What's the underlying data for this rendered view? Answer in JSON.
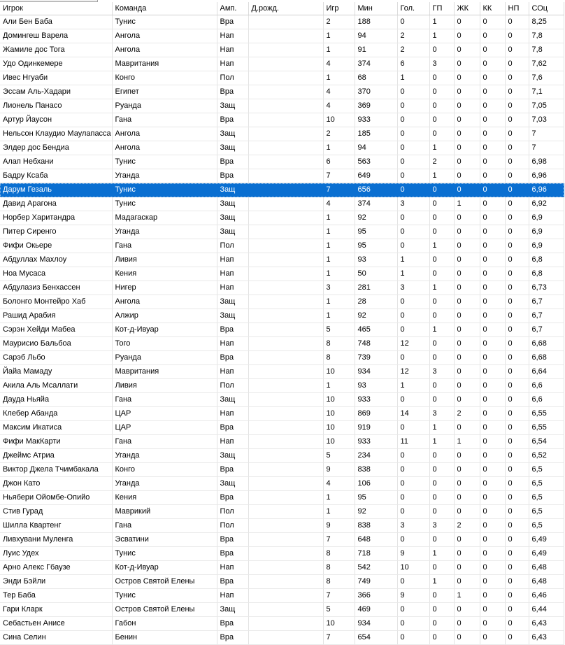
{
  "columns": [
    "Игрок",
    "Команда",
    "Амп.",
    "Д.рожд.",
    "Игр",
    "Мин",
    "Гол.",
    "ГП",
    "ЖК",
    "КК",
    "НП",
    "СОц"
  ],
  "selected_row": 12,
  "colors": {
    "selected_bg": "#0a6fd1",
    "selected_text": "#ffffff",
    "grid_line": "#e3e3e3",
    "background": "#ffffff"
  },
  "rows": [
    [
      "Али Бен Баба",
      "Тунис",
      "Вра",
      "",
      "2",
      "188",
      "0",
      "1",
      "0",
      "0",
      "0",
      "8,25"
    ],
    [
      "Домингеш Варела",
      "Ангола",
      "Нап",
      "",
      "1",
      "94",
      "2",
      "1",
      "0",
      "0",
      "0",
      "7,8"
    ],
    [
      "Жамиле дос Тога",
      "Ангола",
      "Нап",
      "",
      "1",
      "91",
      "2",
      "0",
      "0",
      "0",
      "0",
      "7,8"
    ],
    [
      "Удо Одинкемере",
      "Мавритания",
      "Нап",
      "",
      "4",
      "374",
      "6",
      "3",
      "0",
      "0",
      "0",
      "7,62"
    ],
    [
      "Ивес Нгуаби",
      "Конго",
      "Пол",
      "",
      "1",
      "68",
      "1",
      "0",
      "0",
      "0",
      "0",
      "7,6"
    ],
    [
      "Эссам Аль-Хадари",
      "Египет",
      "Вра",
      "",
      "4",
      "370",
      "0",
      "0",
      "0",
      "0",
      "0",
      "7,1"
    ],
    [
      "Лионель Панасо",
      "Руанда",
      "Защ",
      "",
      "4",
      "369",
      "0",
      "0",
      "0",
      "0",
      "0",
      "7,05"
    ],
    [
      "Артур Йаусон",
      "Гана",
      "Вра",
      "",
      "10",
      "933",
      "0",
      "0",
      "0",
      "0",
      "0",
      "7,03"
    ],
    [
      "Нельсон Клаудио Маулапасса",
      "Ангола",
      "Защ",
      "",
      "2",
      "185",
      "0",
      "0",
      "0",
      "0",
      "0",
      "7"
    ],
    [
      "Элдер дос Бендиа",
      "Ангола",
      "Защ",
      "",
      "1",
      "94",
      "0",
      "1",
      "0",
      "0",
      "0",
      "7"
    ],
    [
      "Алап Небхани",
      "Тунис",
      "Вра",
      "",
      "6",
      "563",
      "0",
      "2",
      "0",
      "0",
      "0",
      "6,98"
    ],
    [
      "Бадру Ксаба",
      "Уганда",
      "Вра",
      "",
      "7",
      "649",
      "0",
      "1",
      "0",
      "0",
      "0",
      "6,96"
    ],
    [
      "Дарум Гезаль",
      "Тунис",
      "Защ",
      "",
      "7",
      "656",
      "0",
      "0",
      "0",
      "0",
      "0",
      "6,96"
    ],
    [
      "Давид Арагона",
      "Тунис",
      "Защ",
      "",
      "4",
      "374",
      "3",
      "0",
      "1",
      "0",
      "0",
      "6,92"
    ],
    [
      "Норбер Харитандра",
      "Мадагаскар",
      "Защ",
      "",
      "1",
      "92",
      "0",
      "0",
      "0",
      "0",
      "0",
      "6,9"
    ],
    [
      "Питер Сиренго",
      "Уганда",
      "Защ",
      "",
      "1",
      "95",
      "0",
      "0",
      "0",
      "0",
      "0",
      "6,9"
    ],
    [
      "Фифи Окьере",
      "Гана",
      "Пол",
      "",
      "1",
      "95",
      "0",
      "1",
      "0",
      "0",
      "0",
      "6,9"
    ],
    [
      "Абдуллах Махлоу",
      "Ливия",
      "Нап",
      "",
      "1",
      "93",
      "1",
      "0",
      "0",
      "0",
      "0",
      "6,8"
    ],
    [
      "Ноа Мусаса",
      "Кения",
      "Нап",
      "",
      "1",
      "50",
      "1",
      "0",
      "0",
      "0",
      "0",
      "6,8"
    ],
    [
      "Абдулазиз Бенхассен",
      "Нигер",
      "Нап",
      "",
      "3",
      "281",
      "3",
      "1",
      "0",
      "0",
      "0",
      "6,73"
    ],
    [
      "Болонго Монтейро Хаб",
      "Ангола",
      "Защ",
      "",
      "1",
      "28",
      "0",
      "0",
      "0",
      "0",
      "0",
      "6,7"
    ],
    [
      "Рашид Арабия",
      "Алжир",
      "Защ",
      "",
      "1",
      "92",
      "0",
      "0",
      "0",
      "0",
      "0",
      "6,7"
    ],
    [
      "Сэрэн Хейди Мабеа",
      "Кот-д-Ивуар",
      "Вра",
      "",
      "5",
      "465",
      "0",
      "1",
      "0",
      "0",
      "0",
      "6,7"
    ],
    [
      "Маурисио Бальбоа",
      "Того",
      "Нап",
      "",
      "8",
      "748",
      "12",
      "0",
      "0",
      "0",
      "0",
      "6,68"
    ],
    [
      "Сарэб Льбо",
      "Руанда",
      "Вра",
      "",
      "8",
      "739",
      "0",
      "0",
      "0",
      "0",
      "0",
      "6,68"
    ],
    [
      "Йайа Мамаду",
      "Мавритания",
      "Нап",
      "",
      "10",
      "934",
      "12",
      "3",
      "0",
      "0",
      "0",
      "6,64"
    ],
    [
      "Акила Аль Мсаллати",
      "Ливия",
      "Пол",
      "",
      "1",
      "93",
      "1",
      "0",
      "0",
      "0",
      "0",
      "6,6"
    ],
    [
      "Дауда Ньяйа",
      "Гана",
      "Защ",
      "",
      "10",
      "933",
      "0",
      "0",
      "0",
      "0",
      "0",
      "6,6"
    ],
    [
      "Клебер Абанда",
      "ЦАР",
      "Нап",
      "",
      "10",
      "869",
      "14",
      "3",
      "2",
      "0",
      "0",
      "6,55"
    ],
    [
      "Максим Икатиса",
      "ЦАР",
      "Вра",
      "",
      "10",
      "919",
      "0",
      "1",
      "0",
      "0",
      "0",
      "6,55"
    ],
    [
      "Фифи МакКарти",
      "Гана",
      "Нап",
      "",
      "10",
      "933",
      "11",
      "1",
      "1",
      "0",
      "0",
      "6,54"
    ],
    [
      "Джеймс Атриа",
      "Уганда",
      "Защ",
      "",
      "5",
      "234",
      "0",
      "0",
      "0",
      "0",
      "0",
      "6,52"
    ],
    [
      "Виктор Джела Тчимбакала",
      "Конго",
      "Вра",
      "",
      "9",
      "838",
      "0",
      "0",
      "0",
      "0",
      "0",
      "6,5"
    ],
    [
      "Джон Като",
      "Уганда",
      "Защ",
      "",
      "4",
      "106",
      "0",
      "0",
      "0",
      "0",
      "0",
      "6,5"
    ],
    [
      "Ньябери Ойомбе-Опийо",
      "Кения",
      "Вра",
      "",
      "1",
      "95",
      "0",
      "0",
      "0",
      "0",
      "0",
      "6,5"
    ],
    [
      "Стив Гурад",
      "Маврикий",
      "Пол",
      "",
      "1",
      "92",
      "0",
      "0",
      "0",
      "0",
      "0",
      "6,5"
    ],
    [
      "Шилла Квартенг",
      "Гана",
      "Пол",
      "",
      "9",
      "838",
      "3",
      "3",
      "2",
      "0",
      "0",
      "6,5"
    ],
    [
      "Ливхувани Муленга",
      "Эсватини",
      "Вра",
      "",
      "7",
      "648",
      "0",
      "0",
      "0",
      "0",
      "0",
      "6,49"
    ],
    [
      "Луис Удех",
      "Тунис",
      "Вра",
      "",
      "8",
      "718",
      "9",
      "1",
      "0",
      "0",
      "0",
      "6,49"
    ],
    [
      "Арно Алекс Гбаузе",
      "Кот-д-Ивуар",
      "Нап",
      "",
      "8",
      "542",
      "10",
      "0",
      "0",
      "0",
      "0",
      "6,48"
    ],
    [
      "Энди Бэйли",
      "Остров Святой Елены",
      "Вра",
      "",
      "8",
      "749",
      "0",
      "1",
      "0",
      "0",
      "0",
      "6,48"
    ],
    [
      "Тер Баба",
      "Тунис",
      "Нап",
      "",
      "7",
      "366",
      "9",
      "0",
      "1",
      "0",
      "0",
      "6,46"
    ],
    [
      "Гари Кларк",
      "Остров Святой Елены",
      "Защ",
      "",
      "5",
      "469",
      "0",
      "0",
      "0",
      "0",
      "0",
      "6,44"
    ],
    [
      "Себастьен Анисе",
      "Габон",
      "Вра",
      "",
      "10",
      "934",
      "0",
      "0",
      "0",
      "0",
      "0",
      "6,43"
    ],
    [
      "Сина Селин",
      "Бенин",
      "Вра",
      "",
      "7",
      "654",
      "0",
      "0",
      "0",
      "0",
      "0",
      "6,43"
    ]
  ]
}
